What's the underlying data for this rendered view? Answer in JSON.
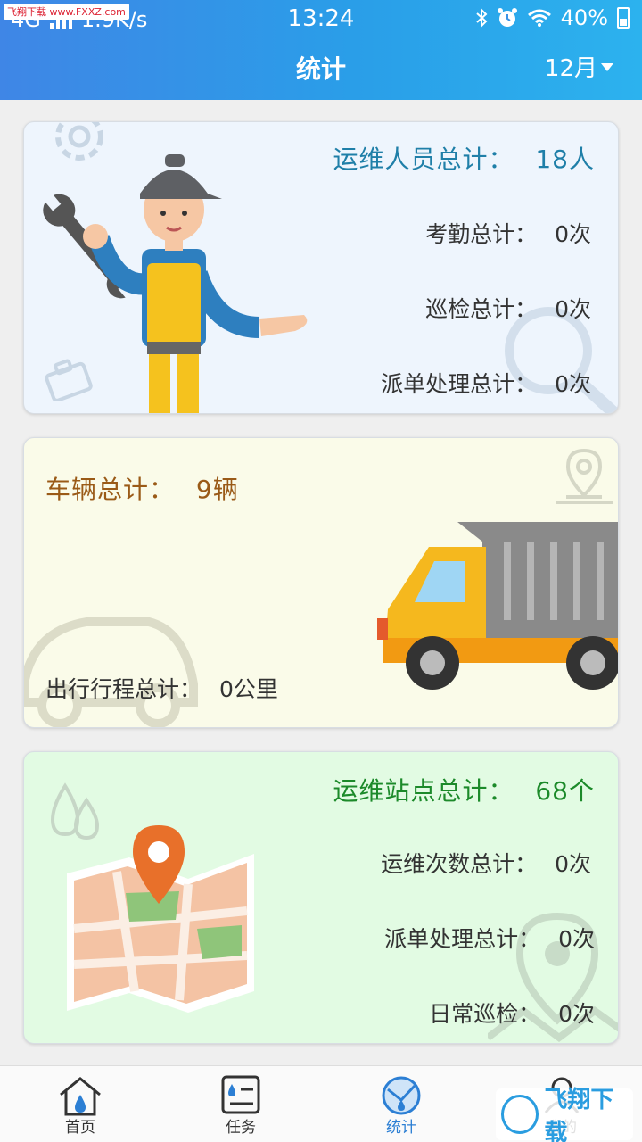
{
  "status_bar": {
    "network": "4G",
    "speed": "1.9K/s",
    "time": "13:24",
    "battery": "40%",
    "watermark": "飞翔下载 www.FXXZ.com"
  },
  "header": {
    "title": "统计",
    "month": "12月"
  },
  "staff_card": {
    "title_label": "运维人员总计：",
    "title_value": "18人",
    "rows": [
      {
        "label": "考勤总计：",
        "value": "0次"
      },
      {
        "label": "巡检总计：",
        "value": "0次"
      },
      {
        "label": "派单处理总计：",
        "value": "0次"
      }
    ],
    "title_color": "#1f7fa8"
  },
  "vehicle_card": {
    "title_label": "车辆总计：",
    "title_value": "9辆",
    "trip_label": "出行行程总计：",
    "trip_value": "0公里",
    "title_color": "#9a5a17"
  },
  "site_card": {
    "title_label": "运维站点总计：",
    "title_value": "68个",
    "rows": [
      {
        "label": "运维次数总计：",
        "value": "0次"
      },
      {
        "label": "派单处理总计：",
        "value": "0次"
      },
      {
        "label": "日常巡检：",
        "value": "0次"
      }
    ],
    "title_color": "#1c8a2a"
  },
  "bottom_nav": [
    {
      "label": "首页",
      "icon": "home-icon",
      "active": false
    },
    {
      "label": "任务",
      "icon": "task-icon",
      "active": false
    },
    {
      "label": "统计",
      "icon": "stats-icon",
      "active": true
    },
    {
      "label": "我的",
      "icon": "user-icon",
      "active": false
    }
  ],
  "brand_text": "飞翔下载",
  "colors": {
    "header_start": "#3f86e6",
    "header_end": "#2cb2ee",
    "active_nav": "#2c7fd4"
  }
}
